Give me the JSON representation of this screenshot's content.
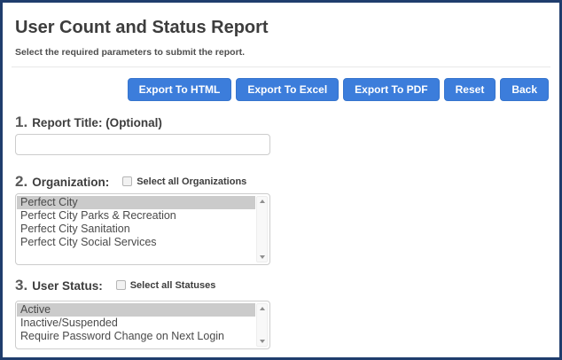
{
  "page": {
    "title": "User Count and Status Report",
    "subtitle": "Select the required parameters to submit the report."
  },
  "toolbar": {
    "buttons": [
      {
        "label": "Export To HTML"
      },
      {
        "label": "Export To Excel"
      },
      {
        "label": "Export To PDF"
      },
      {
        "label": "Reset"
      },
      {
        "label": "Back"
      }
    ]
  },
  "sections": {
    "report_title": {
      "number": "1.",
      "label": "Report Title: (Optional)",
      "input_value": "",
      "input_placeholder": ""
    },
    "organization": {
      "number": "2.",
      "label": "Organization:",
      "select_all_label": "Select all Organizations",
      "select_all_checked": false,
      "options": [
        {
          "label": "Perfect City",
          "selected": true
        },
        {
          "label": "Perfect City Parks & Recreation",
          "selected": false
        },
        {
          "label": "Perfect City Sanitation",
          "selected": false
        },
        {
          "label": "Perfect City Social Services",
          "selected": false
        }
      ]
    },
    "user_status": {
      "number": "3.",
      "label": "User Status:",
      "select_all_label": "Select all Statuses",
      "select_all_checked": false,
      "options": [
        {
          "label": "Active",
          "selected": true
        },
        {
          "label": "Inactive/Suspended",
          "selected": false
        },
        {
          "label": "Require Password Change on Next Login",
          "selected": false
        }
      ]
    }
  },
  "colors": {
    "accent_blue": "#3c7ddb",
    "frame_border": "#1f3d6d",
    "selected_item_bg": "#cbcbcb"
  }
}
